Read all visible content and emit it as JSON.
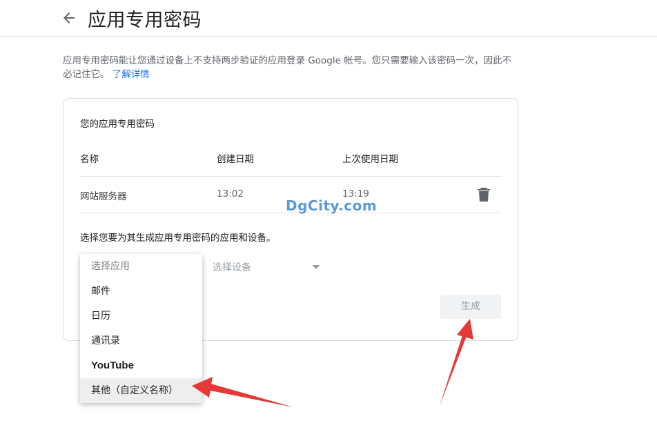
{
  "header": {
    "title": "应用专用密码",
    "back_icon": "arrow-back-icon"
  },
  "intro": {
    "text": "应用专用密码能让您通过设备上不支持两步验证的应用登录 Google 帐号。您只需要输入该密码一次，因此不必记住它。",
    "link": "了解详情"
  },
  "card": {
    "title": "您的应用专用密码",
    "columns": [
      "名称",
      "创建日期",
      "上次使用日期"
    ],
    "rows": [
      {
        "name": "网站服务器",
        "created": "13:02",
        "last_used": "13:19",
        "delete_icon": "trash-icon"
      }
    ],
    "select_prompt": "选择您要为其生成应用专用密码的应用和设备。",
    "device_select": {
      "label": "选择设备",
      "icon": "dropdown-arrow-icon"
    },
    "generate_button": "生成"
  },
  "app_menu": {
    "placeholder": "选择应用",
    "items": [
      "邮件",
      "日历",
      "通讯录",
      "YouTube",
      "其他（自定义名称）"
    ],
    "highlighted_index": 4
  },
  "watermark": "DgCity.com",
  "colors": {
    "accent": "#1a73e8",
    "annotation_arrow": "#e53935",
    "watermark": "#5b9bd5"
  }
}
